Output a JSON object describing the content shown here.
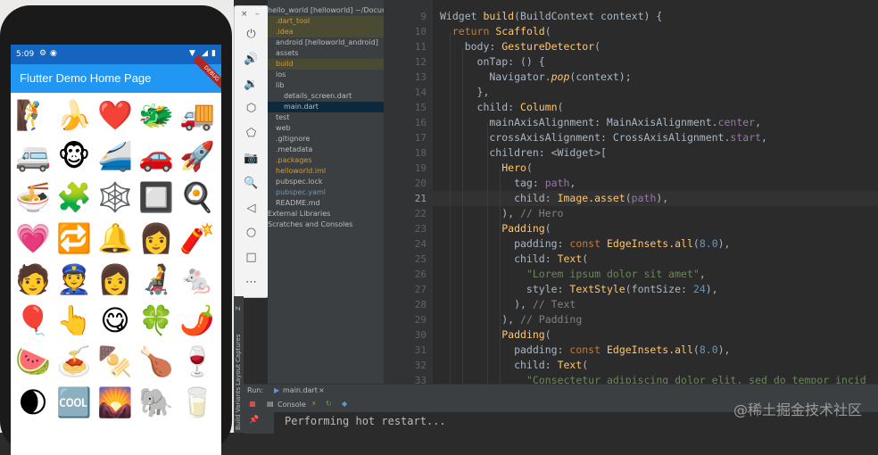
{
  "phone": {
    "status_time": "5:09",
    "app_title": "Flutter Demo Home Page",
    "debug_banner": "DEBUG",
    "emojis": [
      "🧗",
      "🍌",
      "❤️",
      "🐲",
      "🚚",
      "🚐",
      "🐵",
      "🚄",
      "🚗",
      "🚀",
      "🍜",
      "🧩",
      "🕸️",
      "🔲",
      "🍳",
      "💗",
      "🔁",
      "🔔",
      "👩",
      "🧨",
      "🧑",
      "👮",
      "👩",
      "🧑‍🦼",
      "🐁",
      "🎈",
      "👆",
      "😋",
      "🍀",
      "🌶️",
      "🍉",
      "🍝",
      "🍢",
      "🍗",
      "🍷",
      "🌒",
      "🆒",
      "🌄",
      "🐘",
      "🥛"
    ]
  },
  "emulator_toolbar": {
    "close": "×",
    "minimize": "–",
    "buttons": [
      "⏻",
      "🔊",
      "🔉",
      "⬡",
      "⬠",
      "📷",
      "🔍",
      "◁",
      "○",
      "□",
      "⋯"
    ]
  },
  "project_tree": [
    {
      "text": "hello_world [helloworld] ~/Docume",
      "level": 0,
      "style": "normal"
    },
    {
      "text": ".dart_tool",
      "level": 1,
      "style": "orange"
    },
    {
      "text": ".idea",
      "level": 1,
      "style": "orange"
    },
    {
      "text": "android [helloworld_android]",
      "level": 1,
      "style": "normal"
    },
    {
      "text": "assets",
      "level": 1,
      "style": "normal"
    },
    {
      "text": "build",
      "level": 1,
      "style": "orange"
    },
    {
      "text": "ios",
      "level": 1,
      "style": "normal"
    },
    {
      "text": "lib",
      "level": 1,
      "style": "normal"
    },
    {
      "text": "details_screen.dart",
      "level": 2,
      "style": "normal"
    },
    {
      "text": "main.dart",
      "level": 2,
      "style": "normal"
    },
    {
      "text": "test",
      "level": 1,
      "style": "normal"
    },
    {
      "text": "web",
      "level": 1,
      "style": "normal"
    },
    {
      "text": ".gitignore",
      "level": 1,
      "style": "normal"
    },
    {
      "text": ".metadata",
      "level": 1,
      "style": "normal"
    },
    {
      "text": ".packages",
      "level": 1,
      "style": "orange"
    },
    {
      "text": "helloworld.iml",
      "level": 1,
      "style": "orange"
    },
    {
      "text": "pubspec.lock",
      "level": 1,
      "style": "normal"
    },
    {
      "text": "pubspec.yaml",
      "level": 1,
      "style": "cyan"
    },
    {
      "text": "README.md",
      "level": 1,
      "style": "normal"
    },
    {
      "text": "External Libraries",
      "level": 0,
      "style": "normal"
    },
    {
      "text": "Scratches and Consoles",
      "level": 0,
      "style": "normal"
    }
  ],
  "editor": {
    "line_numbers": [
      "9",
      "10",
      "11",
      "12",
      "13",
      "14",
      "15",
      "16",
      "17",
      "18",
      "19",
      "20",
      "21",
      "22",
      "23",
      "24",
      "25",
      "26",
      "27",
      "28",
      "29",
      "30",
      "31",
      "32",
      "33"
    ],
    "current_line": "21"
  },
  "side_strips": {
    "layout_captures": "Layout Captures",
    "build_variants": "Build Variants",
    "z_structure": "Z"
  },
  "run_panel": {
    "run_label": "Run:",
    "run_target": "main.dart",
    "console_tab": "Console",
    "output": "Performing hot restart..."
  },
  "watermark": "@稀土掘金技术社区"
}
